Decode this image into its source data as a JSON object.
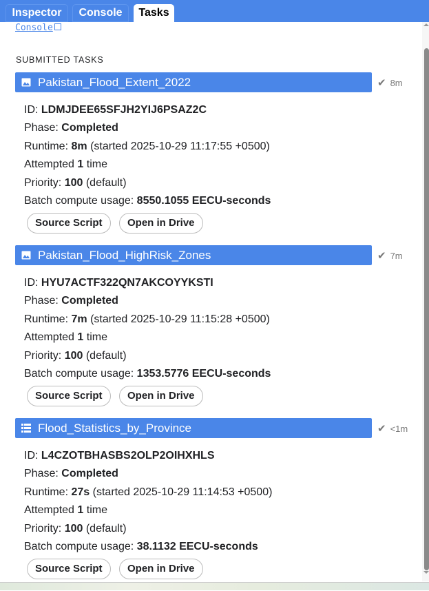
{
  "tabs": [
    {
      "label": "Inspector"
    },
    {
      "label": "Console"
    },
    {
      "label": "Tasks",
      "active": true
    }
  ],
  "console_link": "Console",
  "section_heading": "SUBMITTED TASKS",
  "tasks": [
    {
      "name": "Pakistan_Flood_Extent_2022",
      "icon": "image-icon",
      "status": "8m",
      "id_label": "ID:",
      "id": "LDMJDEE65SFJH2YIJ6PSAZ2C",
      "phase_label": "Phase:",
      "phase": "Completed",
      "runtime_label": "Runtime:",
      "runtime": "8m",
      "started": "(started 2025-10-29 11:17:55 +0500)",
      "attempted_pre": "Attempted",
      "attempts": "1",
      "attempted_post": "time",
      "priority_label": "Priority:",
      "priority": "100",
      "priority_note": "(default)",
      "usage_label": "Batch compute usage:",
      "usage": "8550.1055 EECU-seconds",
      "btn_source": "Source Script",
      "btn_drive": "Open in Drive"
    },
    {
      "name": "Pakistan_Flood_HighRisk_Zones",
      "icon": "image-icon",
      "status": "7m",
      "id_label": "ID:",
      "id": "HYU7ACTF322QN7AKCOYYKSTI",
      "phase_label": "Phase:",
      "phase": "Completed",
      "runtime_label": "Runtime:",
      "runtime": "7m",
      "started": "(started 2025-10-29 11:15:28 +0500)",
      "attempted_pre": "Attempted",
      "attempts": "1",
      "attempted_post": "time",
      "priority_label": "Priority:",
      "priority": "100",
      "priority_note": "(default)",
      "usage_label": "Batch compute usage:",
      "usage": "1353.5776 EECU-seconds",
      "btn_source": "Source Script",
      "btn_drive": "Open in Drive"
    },
    {
      "name": "Flood_Statistics_by_Province",
      "icon": "table-icon",
      "status": "<1m",
      "id_label": "ID:",
      "id": "L4CZOTBHASBS2OLP2OIHXHLS",
      "phase_label": "Phase:",
      "phase": "Completed",
      "runtime_label": "Runtime:",
      "runtime": "27s",
      "started": "(started 2025-10-29 11:14:53 +0500)",
      "attempted_pre": "Attempted",
      "attempts": "1",
      "attempted_post": "time",
      "priority_label": "Priority:",
      "priority": "100",
      "priority_note": "(default)",
      "usage_label": "Batch compute usage:",
      "usage": "38.1132 EECU-seconds",
      "btn_source": "Source Script",
      "btn_drive": "Open in Drive"
    }
  ],
  "colors": {
    "accent": "#4a86e8",
    "status": "#777777"
  }
}
